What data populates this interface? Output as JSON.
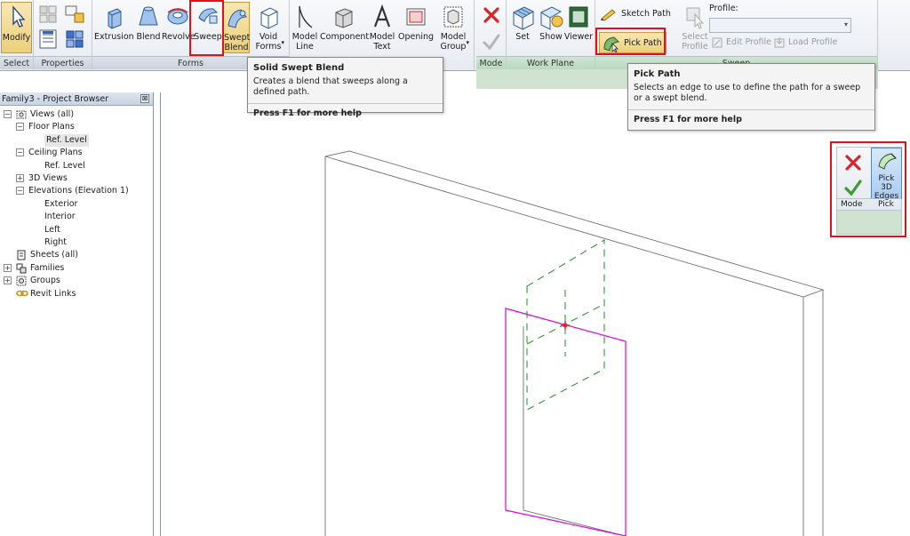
{
  "ribbon": {
    "groups": {
      "select": "Select",
      "properties": "Properties",
      "forms": "Forms",
      "mode": "Mode",
      "work_plane": "Work Plane",
      "sweep": "Sweep"
    },
    "buttons": {
      "modify": "Modify",
      "extrusion": "Extrusion",
      "blend": "Blend",
      "revolve": "Revolve",
      "sweep": "Sweep",
      "swept_blend_1": "Swept",
      "swept_blend_2": "Blend",
      "void_forms_1": "Void",
      "void_forms_2": "Forms",
      "model_line_1": "Model",
      "model_line_2": "Line",
      "component": "Component",
      "model_text_1": "Model",
      "model_text_2": "Text",
      "opening": "Opening",
      "model_group_1": "Model",
      "model_group_2": "Group",
      "set": "Set",
      "show": "Show",
      "viewer": "Viewer",
      "sketch_path": "Sketch Path",
      "pick_path": "Pick Path",
      "select_profile_1": "Select",
      "select_profile_2": "Profile",
      "profile_label": "Profile:",
      "edit_profile": "Edit Profile",
      "load_profile": "Load Profile"
    }
  },
  "tooltips": {
    "swept_blend": {
      "title": "Solid Swept Blend",
      "desc": "Creates a blend that sweeps along a defined path.",
      "help": "Press F1 for more help"
    },
    "pick_path": {
      "title": "Pick Path",
      "desc": "Selects an edge to use to define the path for a sweep or a swept blend.",
      "help": "Press F1 for more help"
    }
  },
  "browser": {
    "title": "Family3 - Project Browser",
    "close": "⊠",
    "items": [
      {
        "label": "Views (all)",
        "level": 0,
        "expander": "−"
      },
      {
        "label": "Floor Plans",
        "level": 1,
        "expander": "−"
      },
      {
        "label": "Ref. Level",
        "level": 2,
        "expander": ""
      },
      {
        "label": "Ceiling Plans",
        "level": 1,
        "expander": "−"
      },
      {
        "label": "Ref. Level",
        "level": 2,
        "expander": ""
      },
      {
        "label": "3D Views",
        "level": 1,
        "expander": "+"
      },
      {
        "label": "Elevations (Elevation 1)",
        "level": 1,
        "expander": "−"
      },
      {
        "label": "Exterior",
        "level": 2,
        "expander": ""
      },
      {
        "label": "Interior",
        "level": 2,
        "expander": ""
      },
      {
        "label": "Left",
        "level": 2,
        "expander": ""
      },
      {
        "label": "Right",
        "level": 2,
        "expander": ""
      },
      {
        "label": "Sheets (all)",
        "level": 0,
        "expander": ""
      },
      {
        "label": "Families",
        "level": 0,
        "expander": "+"
      },
      {
        "label": "Groups",
        "level": 0,
        "expander": "+"
      },
      {
        "label": "Revit Links",
        "level": 0,
        "expander": ""
      }
    ]
  },
  "float_panel": {
    "pick_3d_edges_1": "Pick 3D",
    "pick_3d_edges_2": "Edges",
    "mode": "Mode",
    "pick": "Pick"
  },
  "colors": {
    "highlight": "#e0111b",
    "path_magenta": "#e000e0",
    "workplane_green": "#1f8a2a",
    "cancel_red": "#d8242a",
    "finish_green": "#3c9a34"
  }
}
